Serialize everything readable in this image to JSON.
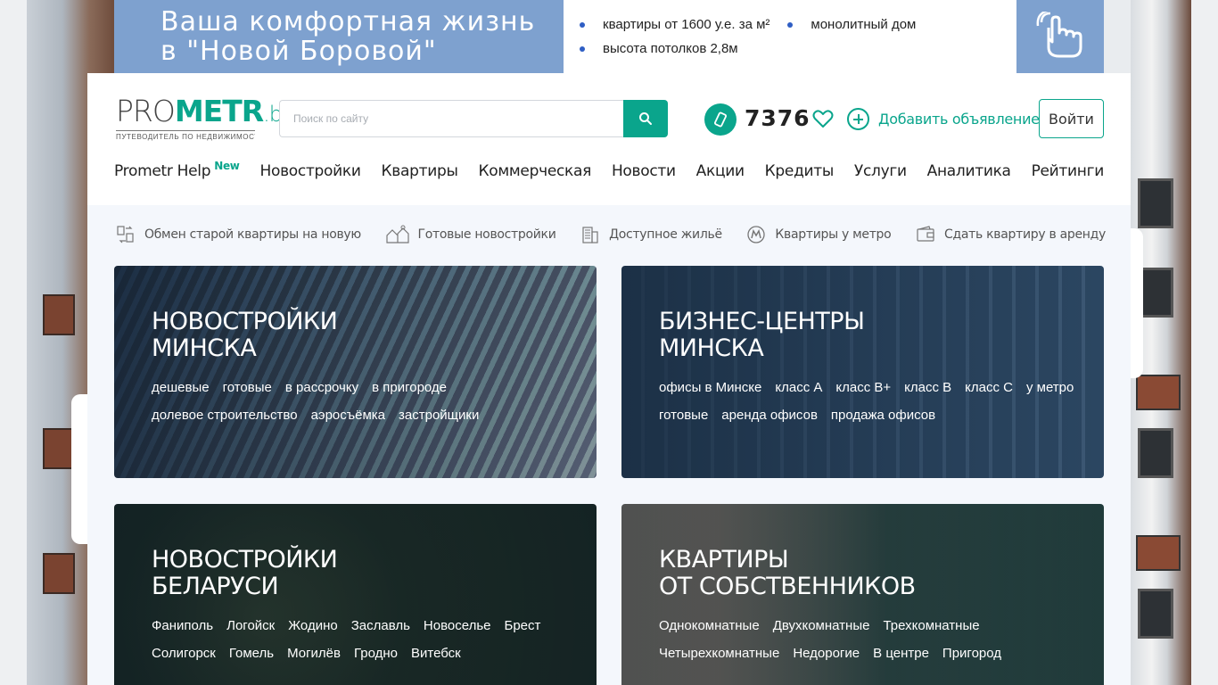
{
  "banner": {
    "headline_line1": "Ваша комфортная жизнь",
    "headline_line2": "в \"Новой Боровой\"",
    "bullets_row1": [
      "квартиры от 1600 у.е. за м²",
      "монолитный дом"
    ],
    "bullets_row2": [
      "высота потолков 2,8м"
    ],
    "bullet_color": "#2f5ec4",
    "bg_color": "#7ea1cf"
  },
  "header": {
    "logo_pro": "PRO",
    "logo_metr": "METR",
    "logo_by": ".by",
    "logo_sub": "ПУТЕВОДИТЕЛЬ ПО НЕДВИЖИМОСТИ",
    "search_placeholder": "Поиск по сайту",
    "phone_number": "7376",
    "add_ad_label": "Добавить объявление",
    "login_label": "Войти",
    "accent_color": "#0aa58c"
  },
  "nav": {
    "items": [
      {
        "label": "Prometr Help",
        "badge": "New"
      },
      {
        "label": "Новостройки"
      },
      {
        "label": "Квартиры"
      },
      {
        "label": "Коммерческая"
      },
      {
        "label": "Новости"
      },
      {
        "label": "Акции"
      },
      {
        "label": "Кредиты"
      },
      {
        "label": "Услуги"
      },
      {
        "label": "Аналитика"
      },
      {
        "label": "Рейтинги"
      }
    ]
  },
  "quick_links": [
    {
      "label": "Обмен старой квартиры на новую",
      "icon": "exchange-icon"
    },
    {
      "label": "Готовые новостройки",
      "icon": "houses-icon"
    },
    {
      "label": "Доступное жильё",
      "icon": "building-icon"
    },
    {
      "label": "Квартиры у метро",
      "icon": "metro-icon"
    },
    {
      "label": "Сдать квартиру в аренду",
      "icon": "wallet-icon"
    }
  ],
  "cards": [
    {
      "title_line1": "НОВОСТРОЙКИ",
      "title_line2": "МИНСКА",
      "links": [
        "дешевые",
        "готовые",
        "в рассрочку",
        "в пригороде",
        "долевое строительство",
        "аэросъёмка",
        "застройщики"
      ]
    },
    {
      "title_line1": "БИЗНЕС-ЦЕНТРЫ",
      "title_line2": "МИНСКА",
      "links": [
        "офисы в Минске",
        "класс А",
        "класс В+",
        "класс В",
        "класс С",
        "у метро",
        "готовые",
        "аренда офисов",
        "продажа офисов"
      ]
    },
    {
      "title_line1": "НОВОСТРОЙКИ",
      "title_line2": "БЕЛАРУСИ",
      "links": [
        "Фаниполь",
        "Логойск",
        "Жодино",
        "Заславль",
        "Новоселье",
        "Брест",
        "Солигорск",
        "Гомель",
        "Могилёв",
        "Гродно",
        "Витебск"
      ]
    },
    {
      "title_line1": "КВАРТИРЫ",
      "title_line2": "ОТ СОБСТВЕННИКОВ",
      "links": [
        "Однокомнатные",
        "Двухкомнатные",
        "Трехкомнатные",
        "Четырехкомнатные",
        "Недорогие",
        "В центре",
        "Пригород"
      ]
    }
  ]
}
